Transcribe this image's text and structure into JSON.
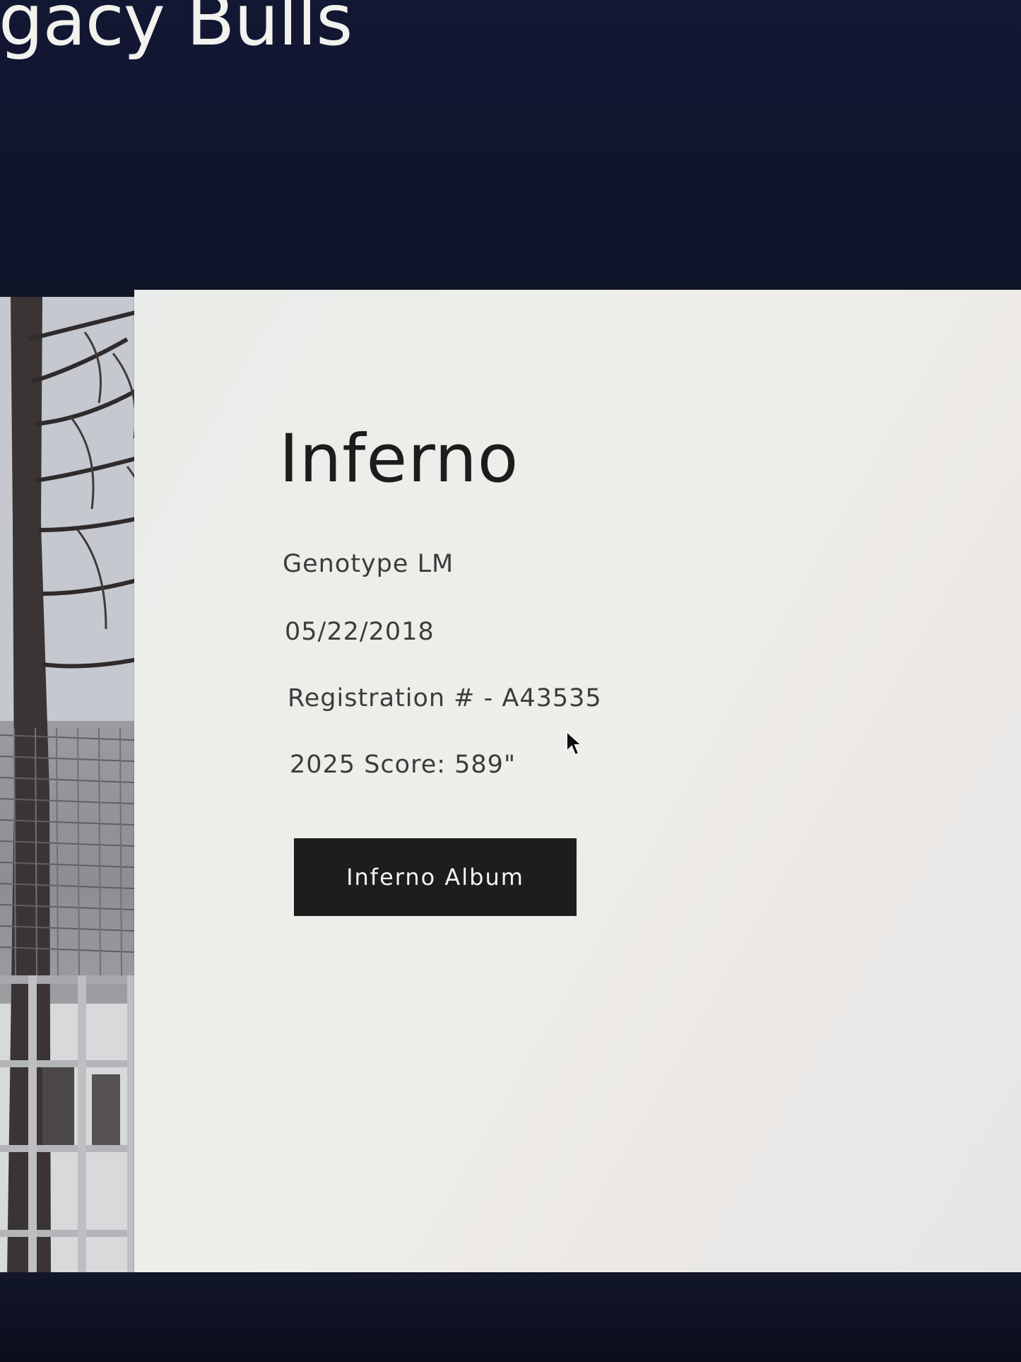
{
  "header": {
    "section_title": "gacy Bulls"
  },
  "bull": {
    "name": "Inferno",
    "genotype": "Genotype LM",
    "date": "05/22/2018",
    "registration": "Registration # - A43535",
    "score": "2025 Score: 589\"",
    "album_button_label": "Inferno Album"
  },
  "colors": {
    "header_background": "#121733",
    "card_background": "#ecede9",
    "button_background": "#1f1c1e",
    "button_text": "#f4f4f4"
  },
  "icons": {
    "cursor": "mouse-pointer-icon"
  }
}
